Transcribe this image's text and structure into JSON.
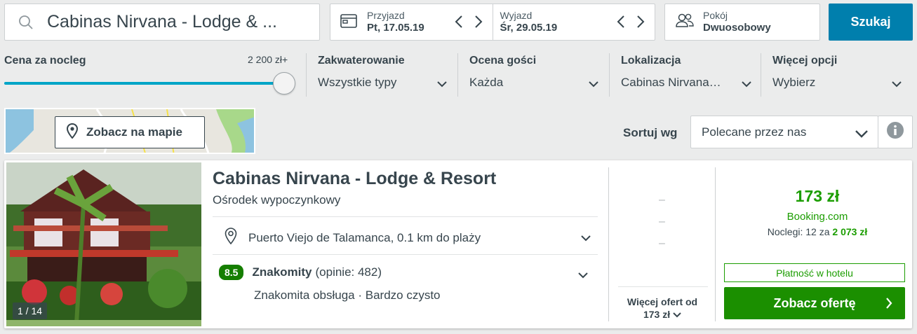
{
  "search": {
    "destination": "Cabinas Nirvana - Lodge & ..."
  },
  "dates": {
    "checkin_label": "Przyjazd",
    "checkin_value": "Pt, 17.05.19",
    "checkout_label": "Wyjazd",
    "checkout_value": "Śr, 29.05.19"
  },
  "room": {
    "label": "Pokój",
    "value": "Dwuosobowy"
  },
  "search_button": "Szukaj",
  "filters": {
    "price": {
      "label": "Cena za nocleg",
      "max_label": "2 200 zł+",
      "level": 1.0
    },
    "accommodation": {
      "label": "Zakwaterowanie",
      "value": "Wszystkie typy"
    },
    "rating": {
      "label": "Ocena gości",
      "value": "Każda"
    },
    "location": {
      "label": "Lokalizacja",
      "value": "Cabinas Nirvana…"
    },
    "more": {
      "label": "Więcej opcji",
      "value": "Wybierz"
    }
  },
  "map": {
    "button_label": "Zobacz na mapie"
  },
  "sort": {
    "label": "Sortuj wg",
    "value": "Polecane przez nas"
  },
  "result": {
    "photo_counter": "1 / 14",
    "name": "Cabinas Nirvana - Lodge & Resort",
    "type": "Ośrodek wypoczynkowy",
    "location": "Puerto Viejo de Talamanca, 0.1 km do plaży",
    "rating_score": "8.5",
    "rating_word": "Znakomity",
    "rating_count": "(opinie: 482)",
    "rating_highlights": "Znakomita obsługa · Bardzo czysto",
    "dashes": [
      "–",
      "–",
      "–"
    ],
    "more_offers_line1": "Więcej ofert od",
    "more_offers_line2": "173 zł",
    "price": "173 zł",
    "provider": "Booking.com",
    "nights_prefix": "Noclegi: 12 za",
    "nights_total": "2 073 zł",
    "pay_at_hotel": "Płatność w hotelu",
    "offer_button": "Zobacz ofertę"
  },
  "colors": {
    "accent_blue": "#007fad",
    "slider": "#00a5c7",
    "green": "#1b9d00",
    "button_green": "#1b8f00",
    "rating_badge": "#157e00"
  },
  "icons": {
    "search": "search-icon",
    "calendar": "calendar-icon",
    "guests": "users-icon",
    "map_pin": "map-pin-icon",
    "info": "info-icon",
    "location": "location-pin-icon"
  }
}
